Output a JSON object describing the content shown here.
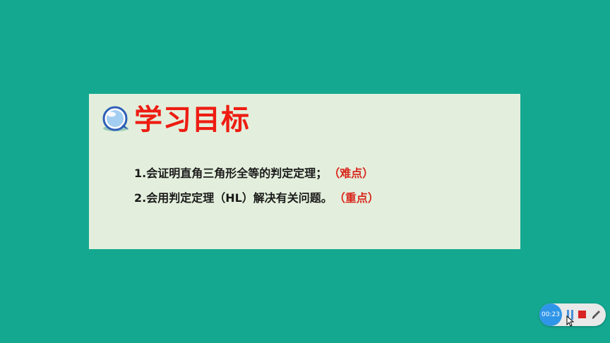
{
  "slide": {
    "title": "学习目标",
    "objectives": [
      {
        "text": "1.会证明直角三角形全等的判定定理；",
        "tag": "（难点）"
      },
      {
        "text": "2.会用判定定理（HL）解决有关问题。",
        "tag": "（重点）"
      }
    ]
  },
  "player": {
    "timer": "00:23"
  },
  "icons": {
    "bubble": "speech-bubble-icon",
    "pause": "pause-icon",
    "stop": "stop-icon",
    "pen": "pen-icon",
    "cursor": "mouse-cursor-icon"
  },
  "colors": {
    "background": "#14a891",
    "card": "#e3efdc",
    "title": "#ee1c12",
    "tag": "#d9261c",
    "timer": "#2f95e8",
    "stop": "#d82424"
  }
}
